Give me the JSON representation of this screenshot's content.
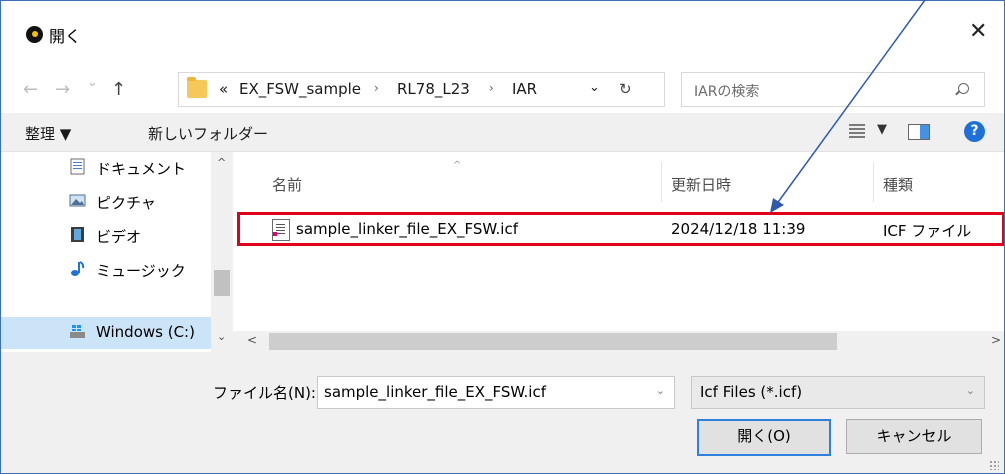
{
  "window": {
    "title": "開く",
    "close_glyph": "✕"
  },
  "navigation": {
    "back_glyph": "←",
    "forward_glyph": "→",
    "recent_glyph": "⌄",
    "up_glyph": "↑",
    "breadcrumb_overflow": "«",
    "breadcrumbs": [
      "EX_FSW_sample",
      "RL78_L23",
      "IAR"
    ],
    "crumb_separator": "›",
    "history_glyph": "⌄",
    "refresh_glyph": "↻",
    "search_placeholder": "IARの検索"
  },
  "toolbar": {
    "organize_label": "整理 ▼",
    "new_folder_label": "新しいフォルダー",
    "view_caret": "▼",
    "help_glyph": "?"
  },
  "sidebar": {
    "items": [
      {
        "label": "ドキュメント",
        "icon": "document-icon"
      },
      {
        "label": "ピクチャ",
        "icon": "pictures-icon"
      },
      {
        "label": "ビデオ",
        "icon": "video-icon"
      },
      {
        "label": "ミュージック",
        "icon": "music-icon"
      },
      {
        "label": "Windows (C:)",
        "icon": "drive-icon",
        "selected": true
      }
    ],
    "scroll_up_glyph": "^",
    "scroll_down_glyph": "⌄"
  },
  "file_list": {
    "columns": [
      "名前",
      "更新日時",
      "種類"
    ],
    "sort_indicator": "^",
    "rows": [
      {
        "name": "sample_linker_file_EX_FSW.icf",
        "modified": "2024/12/18 11:39",
        "type": "ICF ファイル"
      }
    ],
    "scroll_left_glyph": "<",
    "scroll_right_glyph": ">"
  },
  "bottom": {
    "filename_label": "ファイル名(N):",
    "filename_value": "sample_linker_file_EX_FSW.icf",
    "filter_value": "Icf Files (*.icf)",
    "dropdown_glyph": "⌄",
    "open_button": "開く(O)",
    "cancel_button": "キャンセル"
  },
  "colors": {
    "highlight_box": "#e0001a",
    "annotation_arrow": "#2f5aa8",
    "selected_nav": "#cce4f7",
    "accent": "#2f7fdc"
  }
}
